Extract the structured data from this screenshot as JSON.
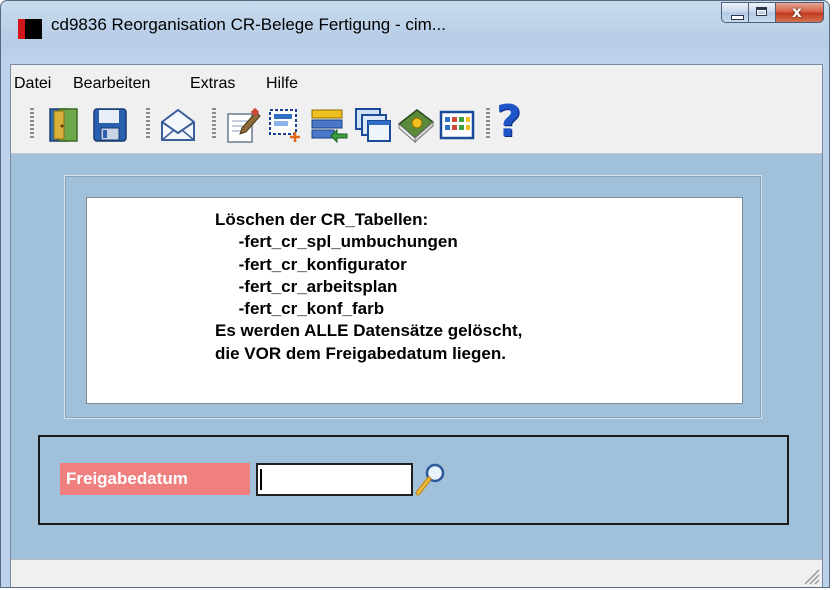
{
  "window": {
    "title": "cd9836 Reorganisation CR-Belege Fertigung - cim...",
    "close_label": "x"
  },
  "menu": {
    "items": [
      "Datei",
      "Bearbeiten",
      "Extras",
      "Hilfe"
    ]
  },
  "toolbar": {
    "icons": [
      "exit-door-icon",
      "save-disk-icon",
      "mail-envelope-icon",
      "edit-document-icon",
      "new-record-icon",
      "transfer-list-icon",
      "windows-cascade-icon",
      "book-help-icon",
      "grid-table-icon",
      "help-question-icon"
    ],
    "help_glyph": "?"
  },
  "info": {
    "lines": [
      "Löschen der CR_Tabellen:",
      "     -fert_cr_spl_umbuchungen",
      "     -fert_cr_konfigurator",
      "     -fert_cr_arbeitsplan",
      "     -fert_cr_konf_farb",
      "Es werden ALLE Datensätze gelöscht,",
      "die VOR dem Freigabedatum liegen."
    ]
  },
  "form": {
    "freigabedatum_label": "Freigabedatum",
    "freigabedatum_value": "",
    "lookup_icon": "magnifier-icon"
  },
  "colors": {
    "content_bg": "#a1c0d9",
    "label_bg": "#f08080",
    "window_frame": "#b7cde6"
  }
}
